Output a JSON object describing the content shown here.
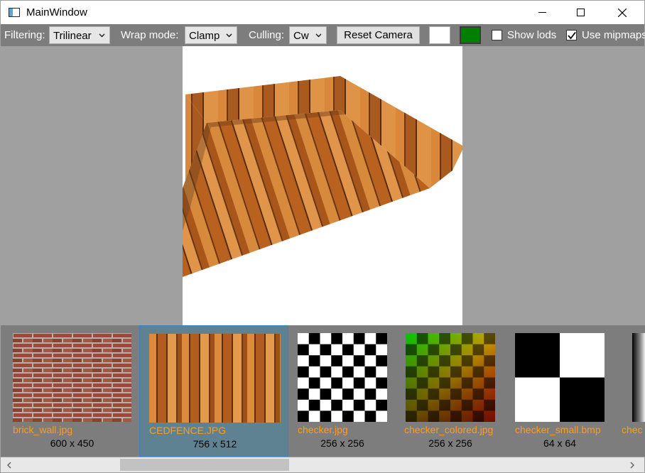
{
  "window": {
    "title": "MainWindow"
  },
  "toolbar": {
    "filtering_label": "Filtering:",
    "filtering_value": "Trilinear",
    "wrap_label": "Wrap mode:",
    "wrap_value": "Clamp",
    "culling_label": "Culling:",
    "culling_value": "Cw",
    "reset_camera_label": "Reset Camera",
    "background_color": "#ffffff",
    "foreground_color": "#007f00",
    "show_lods_label": "Show lods",
    "show_lods_checked": false,
    "use_mipmaps_label": "Use mipmaps",
    "use_mipmaps_checked": true
  },
  "textures": [
    {
      "name": "brick_wall.jpg",
      "dims": "600 x 450",
      "selected": false,
      "icon": "brick-texture"
    },
    {
      "name": "CEDFENCE.JPG",
      "dims": "756 x 512",
      "selected": true,
      "icon": "wood-texture"
    },
    {
      "name": "checker.jpg",
      "dims": "256 x 256",
      "selected": false,
      "icon": "checker-texture"
    },
    {
      "name": "checker_colored.jpg",
      "dims": "256 x 256",
      "selected": false,
      "icon": "colored-checker-texture"
    },
    {
      "name": "checker_small.bmp",
      "dims": "64 x 64",
      "selected": false,
      "icon": "small-checker-texture"
    },
    {
      "name": "chec",
      "dims": "",
      "selected": false,
      "icon": "gradient-texture"
    }
  ],
  "colors": {
    "toolbar_bg": "#7d7d7d",
    "main_bg": "#a0a0a0",
    "selected_thumb_bg": "#5f8293",
    "filename_color": "#ff9d17"
  }
}
